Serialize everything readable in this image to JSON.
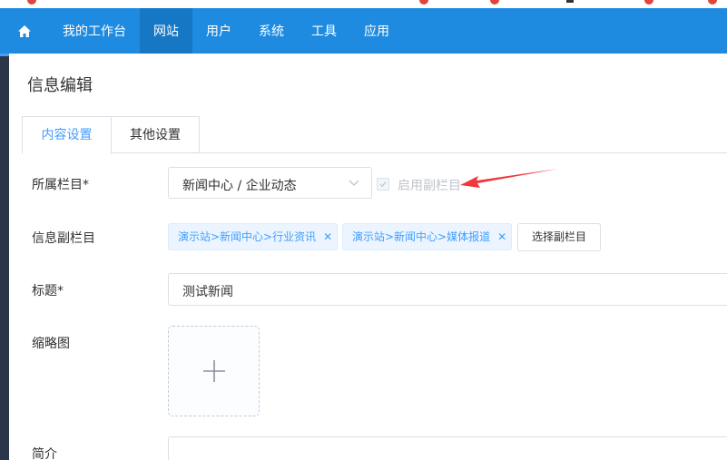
{
  "nav": {
    "items": [
      {
        "label": "我的工作台"
      },
      {
        "label": "网站"
      },
      {
        "label": "用户"
      },
      {
        "label": "系统"
      },
      {
        "label": "工具"
      },
      {
        "label": "应用"
      }
    ],
    "active_index": 1
  },
  "page": {
    "title": "信息编辑"
  },
  "tabs": [
    {
      "label": "内容设置",
      "active": true
    },
    {
      "label": "其他设置",
      "active": false
    }
  ],
  "form": {
    "category": {
      "label": "所属栏目*",
      "value": "新闻中心 / 企业动态",
      "enable_sub_label": "启用副栏目"
    },
    "sub_category": {
      "label": "信息副栏目",
      "tags": [
        {
          "text": "演示站>新闻中心>行业资讯"
        },
        {
          "text": "演示站>新闻中心>媒体报道"
        }
      ],
      "select_button": "选择副栏目"
    },
    "title": {
      "label": "标题*",
      "value": "测试新闻"
    },
    "thumbnail": {
      "label": "缩略图"
    },
    "summary": {
      "label": "简介"
    }
  },
  "colors": {
    "navbar": "#1e8be0",
    "nav_active": "#1677c4",
    "primary": "#409eff",
    "arrow": "#f0373c"
  }
}
